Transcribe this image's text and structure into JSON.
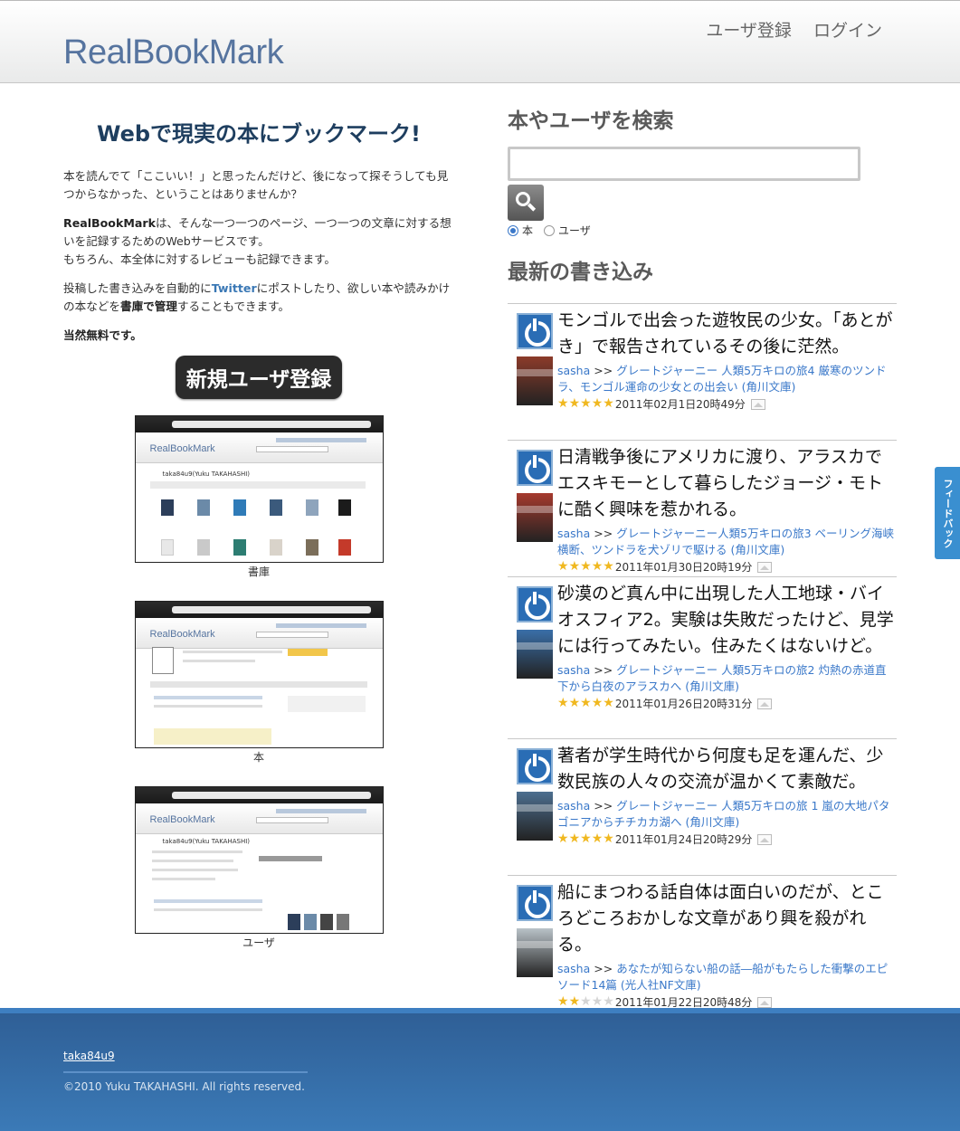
{
  "header": {
    "logo": "RealBookMark",
    "nav": {
      "register": "ユーザ登録",
      "login": "ログイン"
    }
  },
  "intro": {
    "tagline": "Webで現実の本にブックマーク!",
    "p1": "本を読んでて「ここいい！」と思ったんだけど、後になって探そうしても見つからなかった、ということはありませんか？",
    "p2_brand": "RealBookMark",
    "p2_rest": "は、そんな一つ一つのページ、一つ一つの文章に対する想いを記録するためのWebサービスです。",
    "p2_line2": "もちろん、本全体に対するレビューも記録できます。",
    "p3_a": "投稿した書き込みを自動的に",
    "p3_twitter": "Twitter",
    "p3_b": "にポストしたり、欲しい本や読みかけの本などを",
    "p3_bold": "書庫で管理",
    "p3_c": "することもできます。",
    "p4": "当然無料です。",
    "signup_button": "新規ユーザ登録",
    "screenshots": [
      {
        "caption": "書庫",
        "mini_user": "taka84u9(Yuku TAKAHASHI)"
      },
      {
        "caption": "本"
      },
      {
        "caption": "ユーザ",
        "mini_user": "taka84u9(Yuku TAKAHASHI)"
      }
    ],
    "mini_logo": "RealBookMark"
  },
  "search": {
    "heading": "本やユーザを検索",
    "placeholder": "",
    "radio_book": "本",
    "radio_user": "ユーザ",
    "selected": "本"
  },
  "recent": {
    "heading": "最新の書き込み",
    "entries": [
      {
        "comment": "モンゴルで出会った遊牧民の少女。「あとがき」で報告されているその後に茫然。",
        "user": "sasha",
        "book": "グレートジャーニー 人類5万キロの旅4 厳寒のツンドラ、モンゴル運命の少女との出会い (角川文庫)",
        "stars": 5,
        "date": "2011年02月1日20時49分",
        "cover_color": "#8c3b2a"
      },
      {
        "comment": "日清戦争後にアメリカに渡り、アラスカでエスキモーとして暮らしたジョージ・モトに酷く興味を惹かれる。",
        "user": "sasha",
        "book": "グレートジャーニー人類5万キロの旅3 ベーリング海峡横断、ツンドラを犬ゾリで駆ける (角川文庫)",
        "stars": 5,
        "date": "2011年01月30日20時19分",
        "cover_color": "#a63a2e"
      },
      {
        "comment": "砂漠のど真ん中に出現した人工地球・バイオスフィア2。実験は失敗だったけど、見学には行ってみたい。住みたくはないけど。",
        "user": "sasha",
        "book": "グレートジャーニー 人類5万キロの旅2 灼熱の赤道直下から白夜のアラスカへ (角川文庫)",
        "stars": 5,
        "date": "2011年01月26日20時31分",
        "cover_color": "#3a6fa8"
      },
      {
        "comment": "著者が学生時代から何度も足を運んだ、少数民族の人々の交流が温かくて素敵だ。",
        "user": "sasha",
        "book": "グレートジャーニー 人類5万キロの旅 1 嵐の大地パタゴニアからチチカカ湖へ (角川文庫)",
        "stars": 5,
        "date": "2011年01月24日20時29分",
        "cover_color": "#4d6f8f"
      },
      {
        "comment": "船にまつわる話自体は面白いのだが、ところどころおかしな文章があり興を殺がれる。",
        "user": "sasha",
        "book": "あなたが知らない船の話―船がもたらした衝撃のエピソード14篇 (光人社NF文庫)",
        "stars": 2,
        "date": "2011年01月22日20時48分",
        "cover_color": "#b9c2c8"
      }
    ]
  },
  "feedback": {
    "label": "フィードバック"
  },
  "footer": {
    "user_link": "taka84u9",
    "copyright": "©2010 Yuku TAKAHASHI. All rights reserved."
  },
  "colors": {
    "logo": "#56749f",
    "tagline": "#1e3e5f",
    "link": "#3a78c9",
    "footer": "#3b7ab7",
    "star": "#f0b820"
  }
}
